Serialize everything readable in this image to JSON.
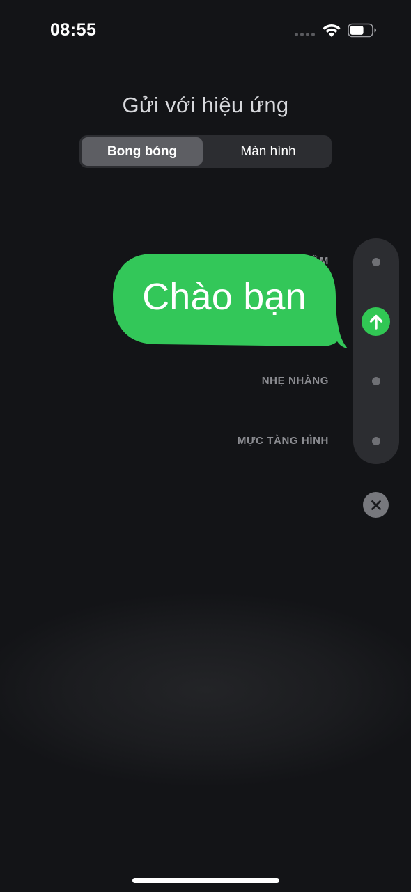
{
  "status_bar": {
    "time": "08:55",
    "icons": [
      "signal-dots-icon",
      "wifi-icon",
      "battery-icon"
    ]
  },
  "header": {
    "title": "Gửi với hiệu ứng"
  },
  "segmented_control": {
    "options": [
      {
        "label": "Bong bóng",
        "selected": true
      },
      {
        "label": "Màn hình",
        "selected": false
      }
    ]
  },
  "effects": {
    "slam_label_visible": "ẦM",
    "gentle_label": "NHẸ NHÀNG",
    "invisible_ink_label": "MỰC TÀNG HÌNH"
  },
  "message": {
    "text": "Chào bạn"
  },
  "colors": {
    "bubble": "#33c759",
    "send_button": "#31c754",
    "background": "#131417"
  }
}
